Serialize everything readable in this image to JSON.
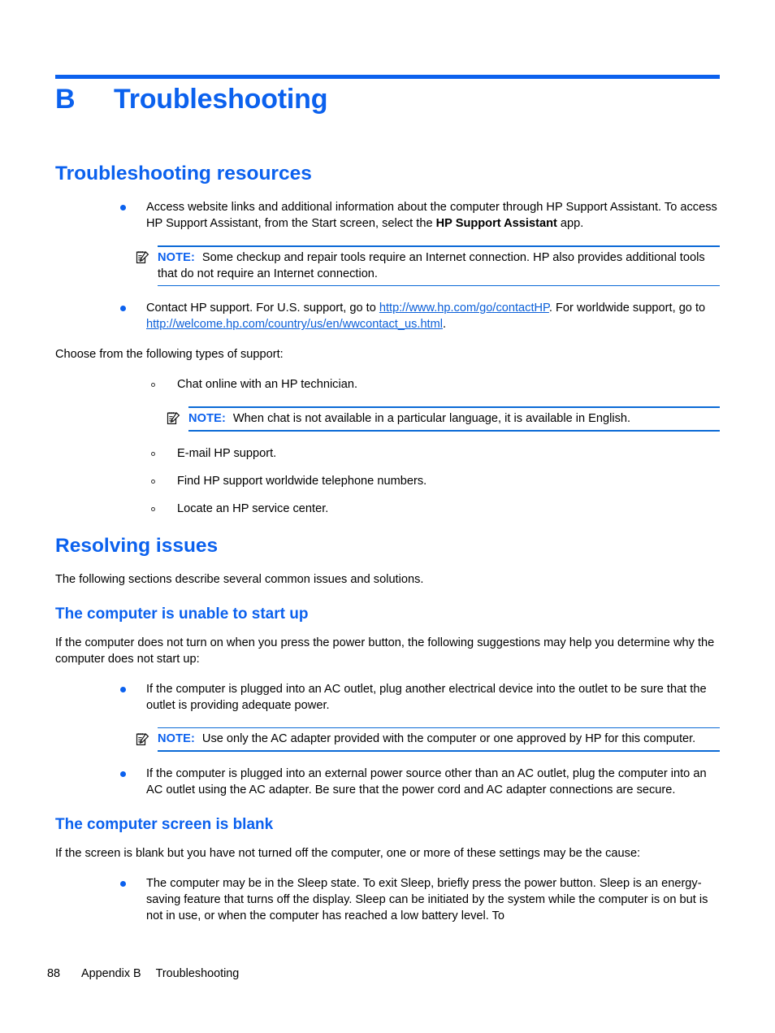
{
  "chapter": {
    "letter": "B",
    "title": "Troubleshooting"
  },
  "colors": {
    "accent_blue": "#0b61ee",
    "link_blue": "#0b5fd8",
    "note_rule": "#0b6ad6",
    "body_text": "#000000"
  },
  "sections": {
    "troubleshooting_resources": {
      "heading": "Troubleshooting resources",
      "bullet1": {
        "text_part1": "Access website links and additional information about the computer through HP Support Assistant. To access HP Support Assistant, from the Start screen, select the ",
        "bold_part": "HP Support Assistant",
        "text_part2": " app."
      },
      "note1": {
        "label": "NOTE:",
        "icon": "note-pencil-icon",
        "text": "Some checkup and repair tools require an Internet connection. HP also provides additional tools that do not require an Internet connection."
      },
      "bullet2": {
        "text_part1": "Contact HP support. For U.S. support, go to ",
        "link1": "http://www.hp.com/go/contactHP",
        "text_part2": ". For worldwide support, go to ",
        "link2": "http://welcome.hp.com/country/us/en/wwcontact_us.html",
        "text_part3": "."
      },
      "choose_line": "Choose from the following types of support:",
      "sub_items": [
        "Chat online with an HP technician.",
        "E-mail HP support.",
        "Find HP support worldwide telephone numbers.",
        "Locate an HP service center."
      ],
      "note2": {
        "label": "NOTE:",
        "icon": "note-pencil-icon",
        "text": "When chat is not available in a particular language, it is available in English."
      }
    },
    "resolving_issues": {
      "heading": "Resolving issues",
      "intro": "The following sections describe several common issues and solutions.",
      "subsection_start_up": {
        "heading": "The computer is unable to start up",
        "intro": "If the computer does not turn on when you press the power button, the following suggestions may help you determine why the computer does not start up:",
        "bullet1": "If the computer is plugged into an AC outlet, plug another electrical device into the outlet to be sure that the outlet is providing adequate power.",
        "note": {
          "label": "NOTE:",
          "icon": "note-pencil-icon",
          "text": "Use only the AC adapter provided with the computer or one approved by HP for this computer."
        },
        "bullet2": "If the computer is plugged into an external power source other than an AC outlet, plug the computer into an AC outlet using the AC adapter. Be sure that the power cord and AC adapter connections are secure."
      },
      "subsection_blank_screen": {
        "heading": "The computer screen is blank",
        "intro": "If the screen is blank but you have not turned off the computer, one or more of these settings may be the cause:",
        "bullet1": "The computer may be in the Sleep state. To exit Sleep, briefly press the power button. Sleep is an energy-saving feature that turns off the display. Sleep can be initiated by the system while the computer is on but is not in use, or when the computer has reached a low battery level. To"
      }
    }
  },
  "footer": {
    "page_number": "88",
    "appendix": "Appendix B",
    "chapter_name": "Troubleshooting"
  }
}
